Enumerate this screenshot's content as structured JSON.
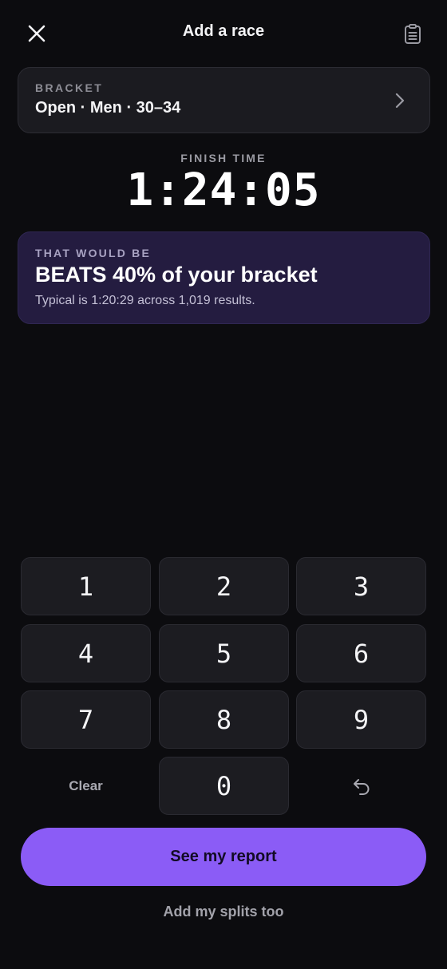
{
  "header": {
    "title": "Add a race",
    "close_icon": "close-icon",
    "clipboard_icon": "clipboard-icon"
  },
  "bracket": {
    "label": "BRACKET",
    "value": "Open · Men · 30–34",
    "chevron_icon": "chevron-right-icon"
  },
  "finish": {
    "label": "FINISH TIME",
    "time": "1:24:05"
  },
  "insight": {
    "label": "THAT WOULD BE",
    "headline": "BEATS 40% of your bracket",
    "subtext": "Typical is 1:20:29 across 1,019 results."
  },
  "keypad": {
    "keys": [
      "1",
      "2",
      "3",
      "4",
      "5",
      "6",
      "7",
      "8",
      "9"
    ],
    "clear_label": "Clear",
    "zero": "0",
    "undo_icon": "undo-icon"
  },
  "actions": {
    "primary_label": "See my report",
    "secondary_label": "Add my splits too"
  },
  "colors": {
    "background": "#0c0c0f",
    "card": "#1b1b20",
    "insight_card": "#241c40",
    "accent": "#8b5cf6"
  }
}
